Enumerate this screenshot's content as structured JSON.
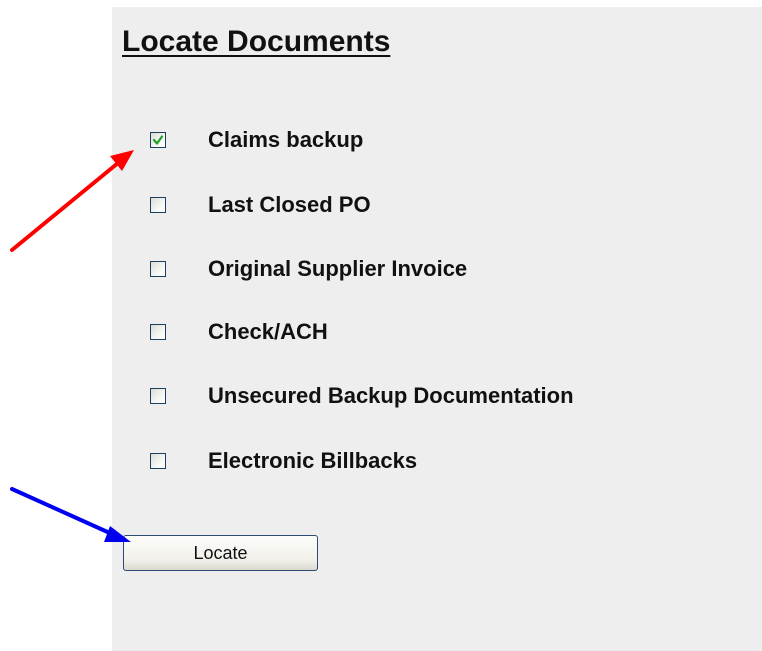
{
  "form": {
    "title": "Locate Documents",
    "options": [
      {
        "label": "Claims backup",
        "checked": true
      },
      {
        "label": "Last Closed PO",
        "checked": false
      },
      {
        "label": "Original Supplier Invoice",
        "checked": false
      },
      {
        "label": "Check/ACH",
        "checked": false
      },
      {
        "label": "Unsecured Backup Documentation",
        "checked": false
      },
      {
        "label": "Electronic Billbacks",
        "checked": false
      }
    ],
    "locate_label": "Locate"
  },
  "annotations": {
    "checkbox_arrow_color": "#ff0000",
    "button_arrow_color": "#0000ee"
  },
  "colors": {
    "panel_background": "#eeeeee",
    "checkmark": "#21a121"
  }
}
